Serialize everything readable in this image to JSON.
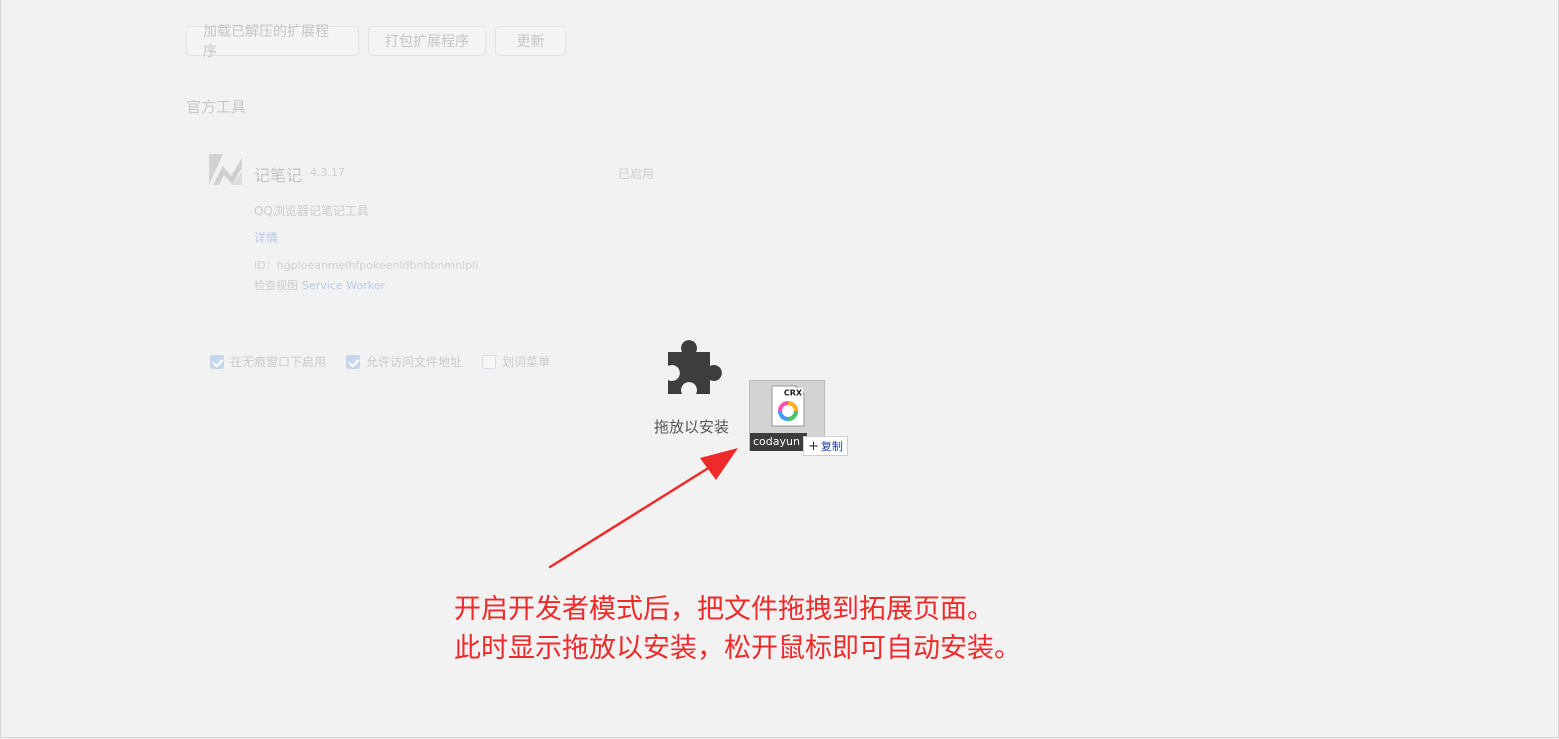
{
  "toolbar": {
    "load_unpacked": "加载已解压的扩展程序",
    "pack_extension": "打包扩展程序",
    "update": "更新"
  },
  "section": {
    "title": "官方工具"
  },
  "extension": {
    "name": "记笔记",
    "version": "4.3.17",
    "status": "已启用",
    "description": "QQ浏览器记笔记工具",
    "details_link": "详情",
    "id_line": "ID：hgploeanmelhfpokeenldbnhbnmnlpli",
    "inspect_label": "检查视图",
    "inspect_link": "Service Worker"
  },
  "options": {
    "incognito": {
      "label": "在无痕窗口下启用",
      "checked": true
    },
    "file_access": {
      "label": "允许访问文件地址",
      "checked": true
    },
    "context_menu": {
      "label": "划词菜单",
      "checked": false
    }
  },
  "drop_zone": {
    "label": "拖放以安装"
  },
  "drag_file": {
    "name": "codayun",
    "badge_text": "CRX",
    "action_label": "复制"
  },
  "annotation": {
    "line1": "开启开发者模式后，把文件拖拽到拓展页面。",
    "line2": "此时显示拖放以安装，松开鼠标即可自动安装。",
    "color": "#f02a2a"
  }
}
